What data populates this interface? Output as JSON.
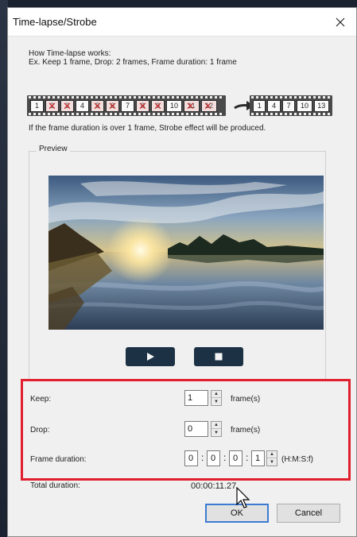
{
  "window": {
    "title": "Time-lapse/Strobe"
  },
  "explanation": {
    "heading": "How Time-lapse works:",
    "example": "Ex. Keep 1 frame, Drop: 2 frames, Frame duration: 1 frame",
    "source_frames": [
      {
        "n": "1",
        "dropped": false
      },
      {
        "n": "2",
        "dropped": true
      },
      {
        "n": "3",
        "dropped": true
      },
      {
        "n": "4",
        "dropped": false
      },
      {
        "n": "5",
        "dropped": true
      },
      {
        "n": "6",
        "dropped": true
      },
      {
        "n": "7",
        "dropped": false
      },
      {
        "n": "8",
        "dropped": true
      },
      {
        "n": "9",
        "dropped": true
      },
      {
        "n": "10",
        "dropped": false
      },
      {
        "n": "11",
        "dropped": true
      },
      {
        "n": "12",
        "dropped": true
      }
    ],
    "result_frames": [
      "1",
      "4",
      "7",
      "10",
      "13"
    ],
    "strobe_note": "If the frame duration is over 1 frame, Strobe effect will be produced."
  },
  "preview": {
    "label": "Preview"
  },
  "settings": {
    "keep": {
      "label": "Keep:",
      "value": "1",
      "unit": "frame(s)"
    },
    "drop": {
      "label": "Drop:",
      "value": "0",
      "unit": "frame(s)"
    },
    "frame_duration": {
      "label": "Frame duration:",
      "h": "0",
      "m": "0",
      "s": "0",
      "f": "1",
      "format": "(H:M:S:f)"
    }
  },
  "total": {
    "label": "Total duration:",
    "value": "00:00:11.27"
  },
  "buttons": {
    "ok": "OK",
    "cancel": "Cancel"
  },
  "colors": {
    "highlight": "#e0202e",
    "media_button": "#1c3244"
  }
}
